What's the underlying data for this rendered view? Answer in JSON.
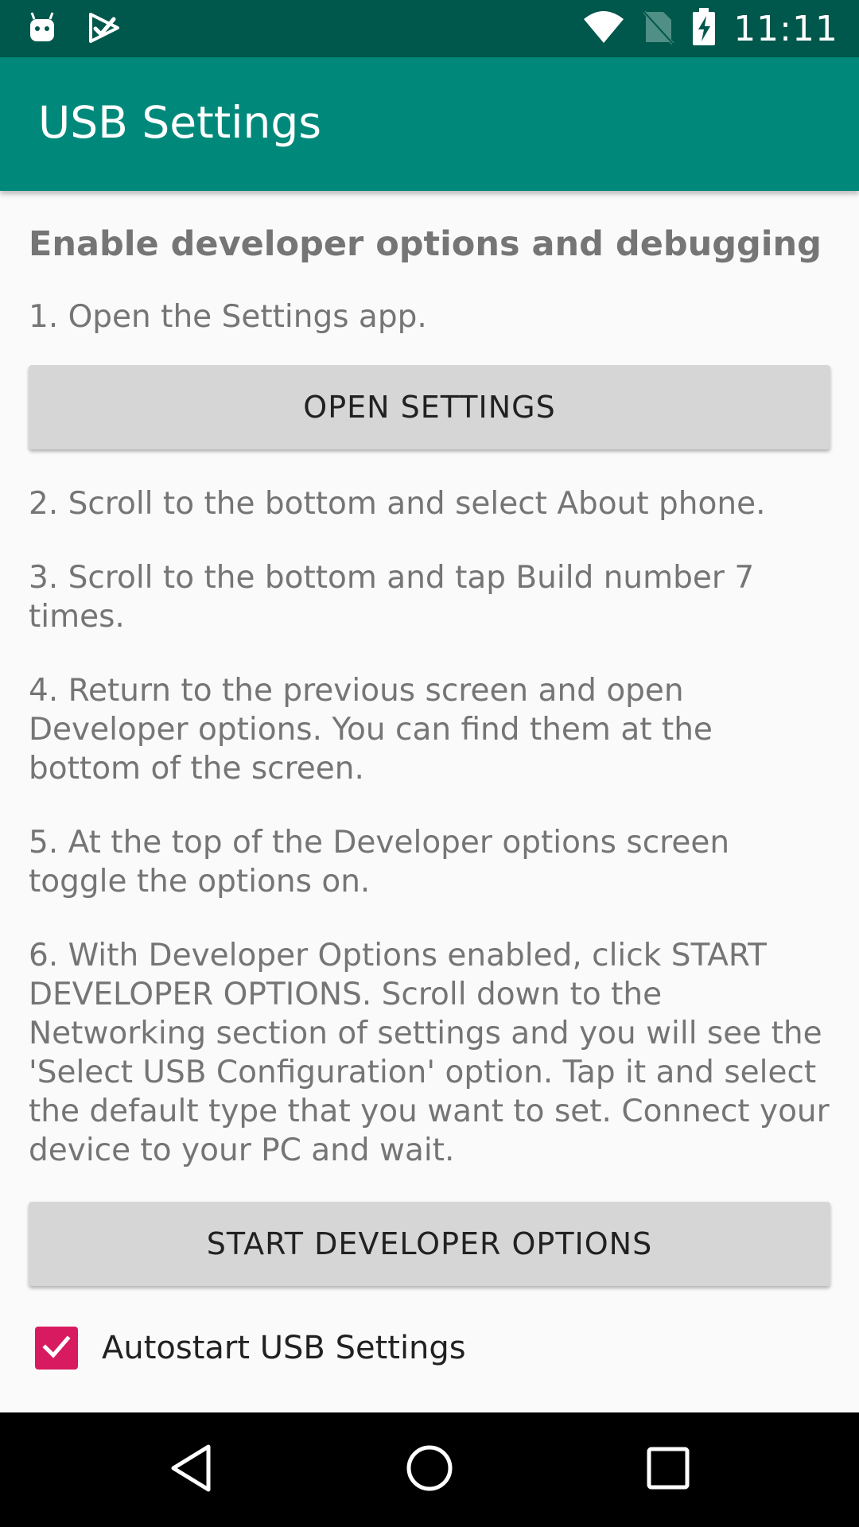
{
  "status_bar": {
    "time": "11:11",
    "icons": [
      "android-icon",
      "play-check-icon",
      "wifi-icon",
      "no-sim-icon",
      "battery-charging-icon"
    ]
  },
  "app_bar": {
    "title": "USB Settings"
  },
  "content": {
    "heading": "Enable developer options and debugging",
    "steps": [
      "1. Open the Settings app.",
      "2. Scroll to the bottom and select About phone.",
      "3. Scroll to the bottom and tap Build number 7 times.",
      "4. Return to the previous screen and open Developer options. You can find them at the bottom of the screen.",
      "5. At the top of the Developer options screen toggle the options on.",
      "6. With Developer Options enabled, click START DEVELOPER OPTIONS. Scroll down to the Networking section of settings and you will see the 'Select USB Configuration' option. Tap it and select the default type that you want to set. Connect your device to your PC and wait."
    ],
    "open_settings_label": "OPEN SETTINGS",
    "start_dev_options_label": "START DEVELOPER OPTIONS",
    "autostart_label": "Autostart USB Settings",
    "autostart_checked": true
  },
  "colors": {
    "status_bar": "#00574b",
    "app_bar": "#00897b",
    "accent": "#d81b60"
  },
  "nav_bar": {
    "icons": [
      "back-icon",
      "home-icon",
      "recents-icon"
    ]
  }
}
